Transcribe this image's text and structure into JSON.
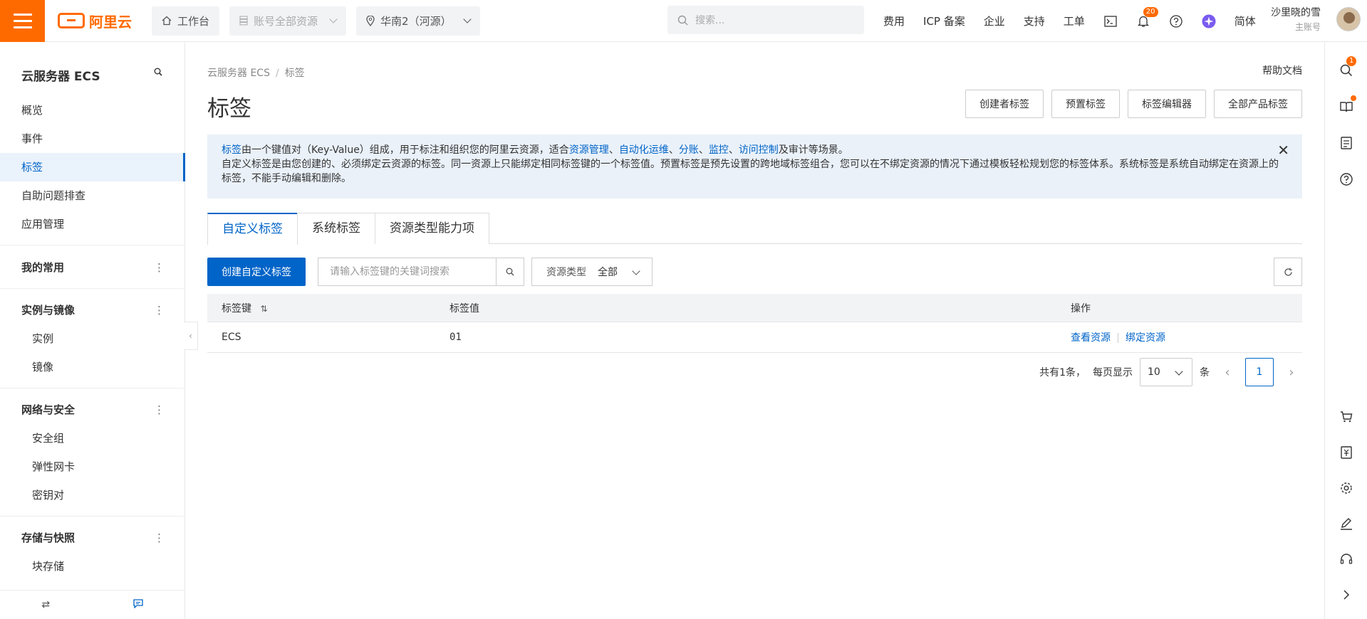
{
  "brand": {
    "logo_text": "阿里云"
  },
  "topbar": {
    "workbench": "工作台",
    "account_scope": "账号全部资源",
    "region": "华南2（河源）",
    "search_placeholder": "搜索...",
    "nav": [
      "费用",
      "ICP 备案",
      "企业",
      "支持",
      "工单"
    ],
    "notification_count": "20",
    "language": "简体",
    "user_name": "沙里晓的雪",
    "user_role": "主账号"
  },
  "sidebar": {
    "title": "云服务器 ECS",
    "items": [
      {
        "label": "概览"
      },
      {
        "label": "事件"
      },
      {
        "label": "标签"
      },
      {
        "label": "自助问题排查"
      },
      {
        "label": "应用管理"
      }
    ],
    "groups": [
      {
        "label": "我的常用",
        "items": []
      },
      {
        "label": "实例与镜像",
        "items": [
          "实例",
          "镜像"
        ]
      },
      {
        "label": "网络与安全",
        "items": [
          "安全组",
          "弹性网卡",
          "密钥对"
        ]
      },
      {
        "label": "存储与快照",
        "items": [
          "块存储"
        ]
      }
    ]
  },
  "rightbar": {
    "search_badge": "1"
  },
  "main": {
    "breadcrumb": [
      "云服务器 ECS",
      "标签"
    ],
    "help_doc": "帮助文档",
    "title": "标签",
    "header_buttons": [
      "创建者标签",
      "预置标签",
      "标签编辑器",
      "全部产品标签"
    ],
    "notice": {
      "link_tag": "标签",
      "part1": "由一个键值对（Key-Value）组成，用于标注和组织您的阿里云资源，适合",
      "link_rm": "资源管理",
      "sep1": "、",
      "link_ops": "自动化运维",
      "sep2": "、",
      "link_bill": "分账",
      "sep3": "、",
      "link_mon": "监控",
      "sep4": "、",
      "link_acl": "访问控制",
      "part2": "及审计等场景。",
      "line2": "自定义标签是由您创建的、必须绑定云资源的标签。同一资源上只能绑定相同标签键的一个标签值。预置标签是预先设置的跨地域标签组合，您可以在不绑定资源的情况下通过模板轻松规划您的标签体系。系统标签是系统自动绑定在资源上的标签，不能手动编辑和删除。"
    },
    "tabs": [
      "自定义标签",
      "系统标签",
      "资源类型能力项"
    ],
    "create_button": "创建自定义标签",
    "search_placeholder": "请输入标签键的关键词搜索",
    "resource_type_label": "资源类型",
    "resource_type_value": "全部",
    "table": {
      "headers": [
        "标签键",
        "标签值",
        "操作"
      ],
      "rows": [
        {
          "key": "ECS",
          "value": "01",
          "actions": [
            "查看资源",
            "绑定资源"
          ]
        }
      ]
    },
    "pagination": {
      "total": "共有1条，",
      "per_page_label": "每页显示",
      "per_page": "10",
      "unit": "条",
      "current": "1"
    }
  },
  "colors": {
    "accent": "#0064c8",
    "brand": "#ff6a00"
  }
}
